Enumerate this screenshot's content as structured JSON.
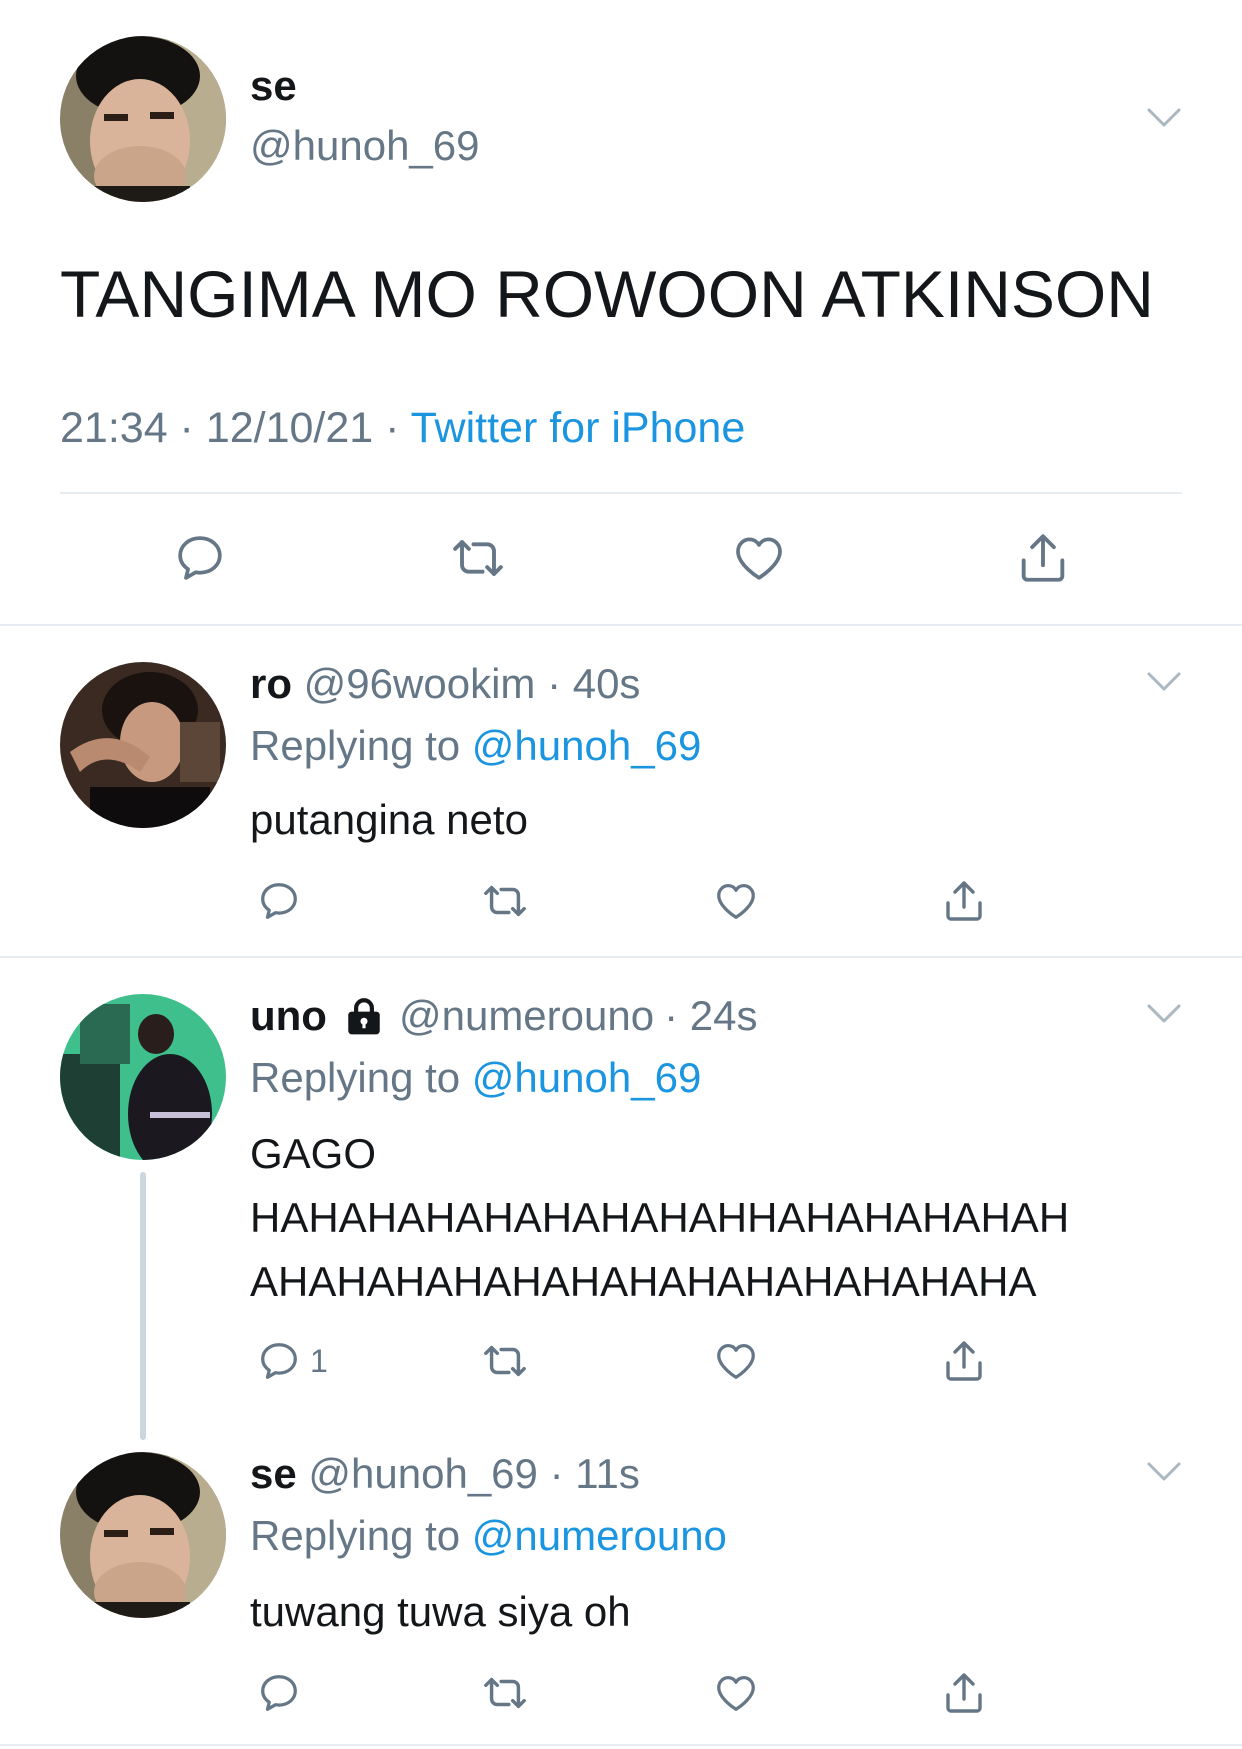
{
  "main_tweet": {
    "name": "se",
    "handle": "@hunoh_69",
    "text": "TANGIMA MO ROWOON ATKINSON",
    "meta": "21:34 · 12/10/21 · ",
    "source": "Twitter for iPhone"
  },
  "replies": [
    {
      "name": "ro",
      "handle": "@96wookim",
      "time": "· 40s",
      "replying_label": "Replying to ",
      "replying_to": "@hunoh_69",
      "text": "putangina neto",
      "reply_count": ""
    },
    {
      "name": "uno",
      "protected": true,
      "handle": "@numerouno",
      "time": "· 24s",
      "replying_label": "Replying to ",
      "replying_to": "@hunoh_69",
      "text_line1": "GAGO",
      "text_line2": "HAHAHAHAHAHAHAHAHHAHAHAHAHAH",
      "text_line3": "AHAHAHAHAHAHAHAHAHAHAHAHAHA",
      "reply_count": "1"
    },
    {
      "name": "se",
      "handle": "@hunoh_69",
      "time": "· 11s",
      "replying_label": "Replying to ",
      "replying_to": "@numerouno",
      "text": "tuwang tuwa siya oh",
      "reply_count": ""
    }
  ],
  "icons": [
    "reply-icon",
    "retweet-icon",
    "like-icon",
    "share-icon",
    "chevron-down-icon",
    "lock-icon"
  ],
  "colors": {
    "blue": "#1b95e0",
    "grey": "#657786",
    "divider": "#e6ecf0",
    "text": "#14171a"
  }
}
